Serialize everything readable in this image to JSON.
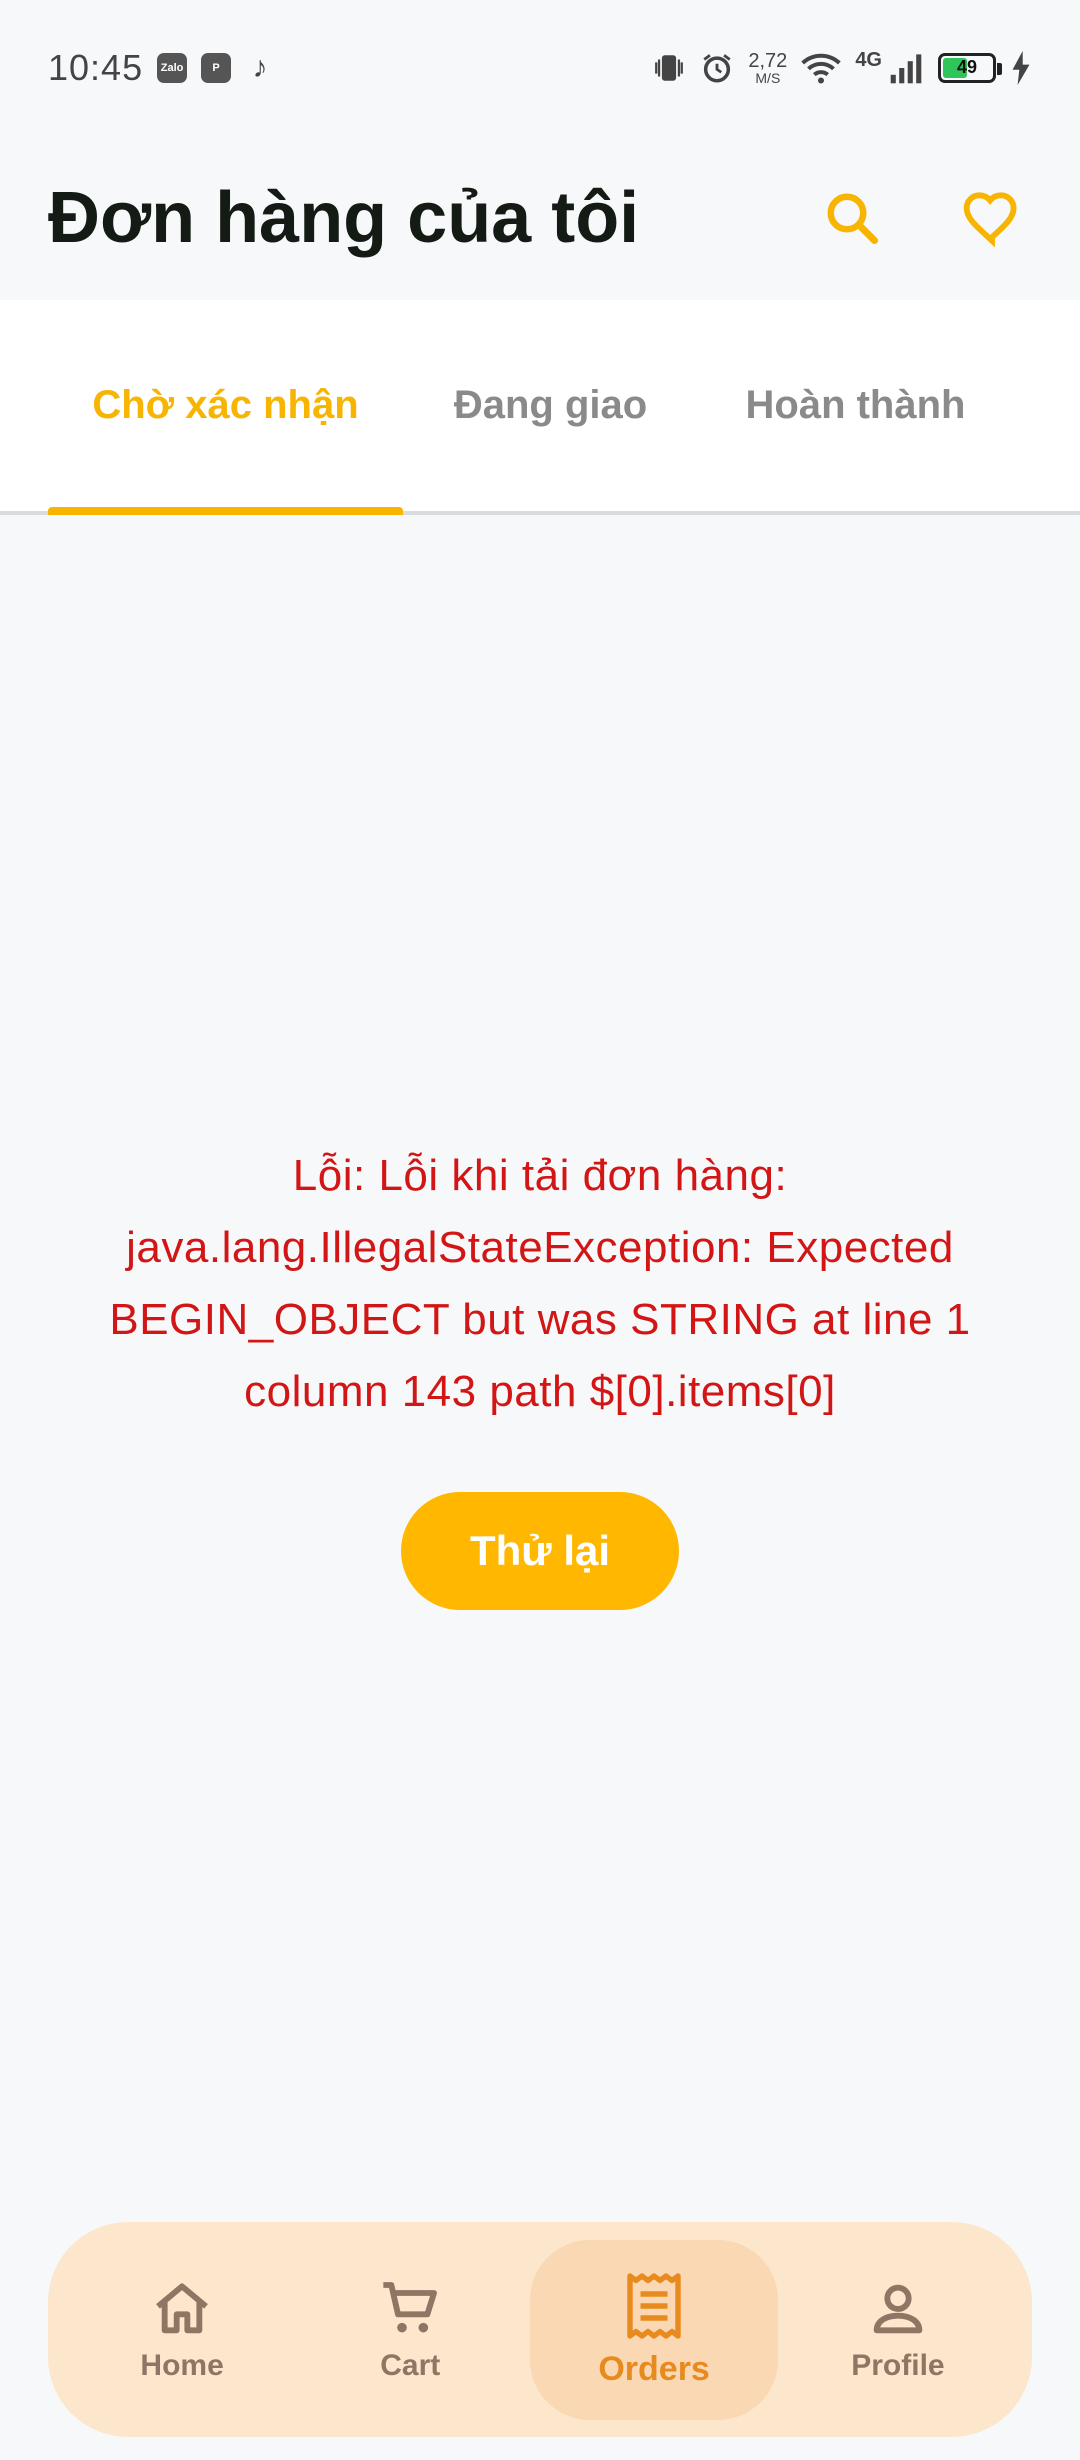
{
  "status_bar": {
    "time": "10:45",
    "apps": [
      "Zalo",
      "P",
      "♪"
    ],
    "net_speed_value": "2,72",
    "net_speed_unit": "M/S",
    "network_type": "4G",
    "battery_level": "49"
  },
  "header": {
    "title": "Đơn hàng của tôi"
  },
  "tabs": [
    {
      "label": "Chờ xác nhận",
      "active": true
    },
    {
      "label": "Đang giao",
      "active": false
    },
    {
      "label": "Hoàn thành",
      "active": false
    }
  ],
  "error": {
    "message": "Lỗi: Lỗi khi tải đơn hàng: java.lang.IllegalStateException: Expected BEGIN_OBJECT but was STRING at line 1 column 143 path $[0].items[0]",
    "retry_label": "Thử lại"
  },
  "bottom_nav": [
    {
      "label": "Home",
      "icon": "home-icon"
    },
    {
      "label": "Cart",
      "icon": "cart-icon"
    },
    {
      "label": "Orders",
      "icon": "receipt-icon",
      "active": true
    },
    {
      "label": "Profile",
      "icon": "person-icon"
    }
  ],
  "colors": {
    "accent": "#f7b400",
    "error": "#d21616",
    "nav_background": "#fce7cc",
    "nav_active": "#e88a1e"
  }
}
